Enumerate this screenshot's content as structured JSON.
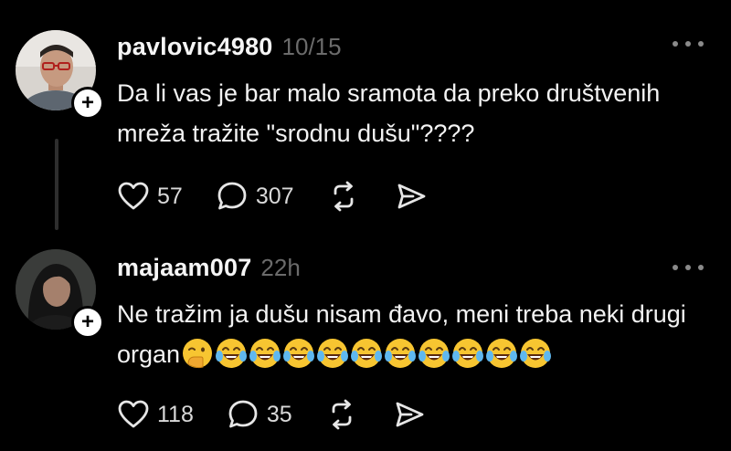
{
  "posts": [
    {
      "username": "pavlovic4980",
      "time": "10/15",
      "text": "Da li vas je bar malo sramota da preko društvenih mreža tražite \"srodnu dušu\"????",
      "likes": "57",
      "replies": "307",
      "avatar_icon": "person-with-glasses",
      "follow_symbol": "+"
    },
    {
      "username": "majaam007",
      "time": "22h",
      "text": "Ne tražim ja dušu nisam đavo, meni treba neki drugi organ",
      "emojis": [
        "face-with-hand-over-mouth",
        "tears-of-joy",
        "tears-of-joy",
        "tears-of-joy",
        "tears-of-joy",
        "tears-of-joy",
        "tears-of-joy",
        "tears-of-joy",
        "tears-of-joy",
        "tears-of-joy",
        "tears-of-joy"
      ],
      "likes": "118",
      "replies": "35",
      "avatar_icon": "woman-dark-hair",
      "follow_symbol": "+"
    }
  ]
}
